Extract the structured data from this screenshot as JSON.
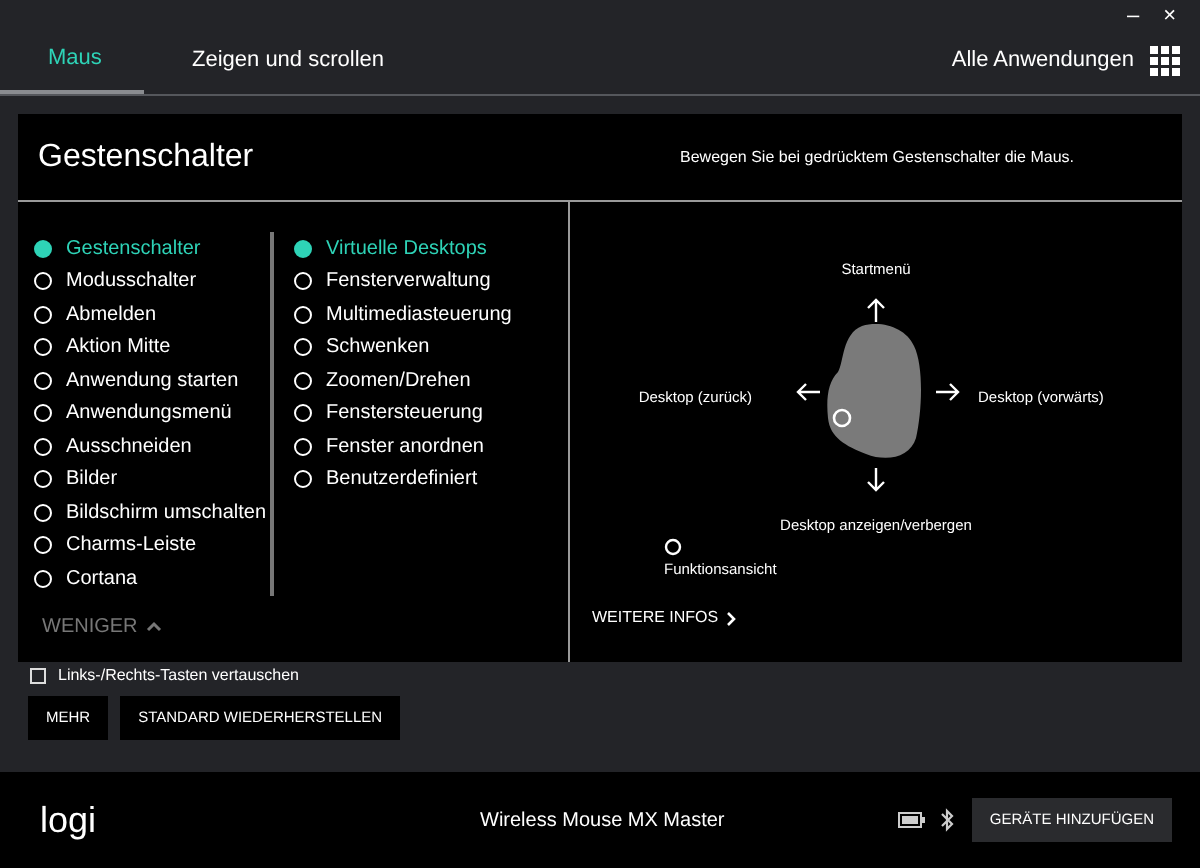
{
  "window": {
    "controls": [
      "–",
      "×"
    ]
  },
  "tabs": [
    {
      "label": "Maus",
      "selected": true
    },
    {
      "label": "Zeigen und scrollen",
      "selected": false
    }
  ],
  "apps_button": {
    "label": "Alle Anwendungen"
  },
  "panel": {
    "title": "Gestenschalter",
    "hint": "Bewegen Sie bei gedrücktem Gestenschalter die Maus.",
    "actions": [
      {
        "label": "Gestenschalter",
        "selected": true
      },
      {
        "label": "Modusschalter",
        "selected": false
      },
      {
        "label": "Abmelden",
        "selected": false
      },
      {
        "label": "Aktion Mitte",
        "selected": false
      },
      {
        "label": "Anwendung starten",
        "selected": false
      },
      {
        "label": "Anwendungsmenü",
        "selected": false
      },
      {
        "label": "Ausschneiden",
        "selected": false
      },
      {
        "label": "Bilder",
        "selected": false
      },
      {
        "label": "Bildschirm umschalten",
        "selected": false
      },
      {
        "label": "Charms-Leiste",
        "selected": false
      },
      {
        "label": "Cortana",
        "selected": false
      }
    ],
    "presets": [
      {
        "label": "Virtuelle Desktops",
        "selected": true
      },
      {
        "label": "Fensterverwaltung",
        "selected": false
      },
      {
        "label": "Multimediasteuerung",
        "selected": false
      },
      {
        "label": "Schwenken",
        "selected": false
      },
      {
        "label": "Zoomen/Drehen",
        "selected": false
      },
      {
        "label": "Fenstersteuerung",
        "selected": false
      },
      {
        "label": "Fenster anordnen",
        "selected": false
      },
      {
        "label": "Benutzerdefiniert",
        "selected": false
      }
    ],
    "less_link": "WENIGER",
    "gestures": {
      "up": "Startmenü",
      "left": "Desktop (zurück)",
      "right": "Desktop (vorwärts)",
      "down": "Desktop anzeigen/verbergen",
      "click": "Funktionsansicht"
    },
    "more_info": "WEITERE INFOS"
  },
  "swap_buttons": {
    "label": "Links-/Rechts-Tasten vertauschen",
    "checked": false
  },
  "buttons": [
    "MEHR",
    "STANDARD WIEDERHERSTELLEN"
  ],
  "footer": {
    "logo": "logi",
    "device": "Wireless Mouse MX Master",
    "add_button": "GERÄTE HINZUFÜGEN"
  }
}
